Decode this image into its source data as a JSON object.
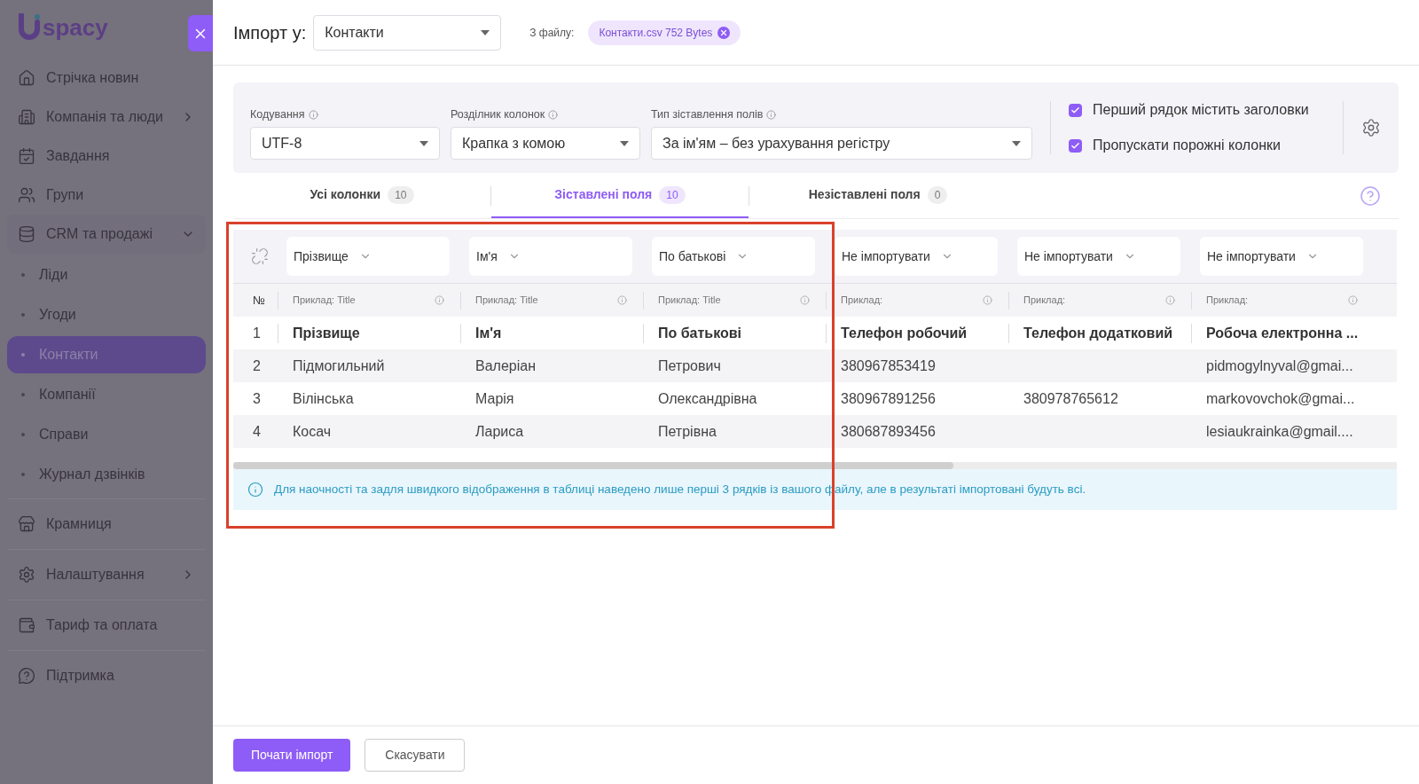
{
  "sidebar": {
    "logo": "spacy",
    "groups": [
      [
        {
          "label": "Стрічка новин"
        },
        {
          "label": "Компанія та люди",
          "expanded": false
        },
        {
          "label": "Завдання"
        },
        {
          "label": "Групи"
        },
        {
          "label": "CRM та продажі",
          "expanded": true,
          "children": [
            {
              "label": "Ліди",
              "selected": false
            },
            {
              "label": "Угоди",
              "selected": false
            },
            {
              "label": "Контакти",
              "selected": true
            },
            {
              "label": "Компанії",
              "selected": false
            },
            {
              "label": "Справи",
              "selected": false
            },
            {
              "label": "Журнал дзвінків",
              "selected": false
            }
          ]
        }
      ],
      [
        {
          "label": "Крамниця"
        }
      ],
      [
        {
          "label": "Налаштування",
          "expanded": false
        }
      ],
      [
        {
          "label": "Тариф та оплата"
        }
      ],
      [
        {
          "label": "Підтримка"
        }
      ]
    ]
  },
  "header": {
    "title": "Імпорт у:",
    "target": "Контакти",
    "file_label": "З файлу:",
    "file": "Контакти.csv 752 Bytes"
  },
  "settings": {
    "fields": [
      {
        "label": "Кодування",
        "value": "UTF-8"
      },
      {
        "label": "Розділник колонок",
        "value": "Крапка з комою"
      },
      {
        "label": "Тип зіставлення полів",
        "value": "За ім'ям – без урахування регістру"
      }
    ],
    "options": [
      {
        "label": "Перший рядок містить заголовки",
        "checked": true
      },
      {
        "label": "Пропускати порожні колонки",
        "checked": true
      }
    ]
  },
  "tabs": [
    {
      "label": "Усі колонки",
      "count": "10",
      "selected": false
    },
    {
      "label": "Зіставлені поля",
      "count": "10",
      "selected": true
    },
    {
      "label": "Незіставлені поля",
      "count": "0",
      "selected": false
    }
  ],
  "table": {
    "number_heading": "№",
    "columns": [
      {
        "field": "Прізвище",
        "example": "Приклад: Title"
      },
      {
        "field": "Ім'я",
        "example": "Приклад: Title"
      },
      {
        "field": "По батькові",
        "example": "Приклад: Title"
      },
      {
        "field": "Не імпортувати",
        "example": "Приклад:"
      },
      {
        "field": "Не імпортувати",
        "example": "Приклад:"
      },
      {
        "field": "Не імпортувати",
        "example": "Приклад:"
      }
    ],
    "rows": [
      {
        "number": "1",
        "kind": "header",
        "cells": [
          "Прізвище",
          "Ім'я",
          "По батькові",
          "Телефон робочий",
          "Телефон додатковий",
          "Робоча електронна ..."
        ]
      },
      {
        "number": "2",
        "kind": "data",
        "cells": [
          "Підмогильний",
          "Валеріан",
          "Петрович",
          "380967853419",
          "",
          "pidmogylnyval@gmai..."
        ]
      },
      {
        "number": "3",
        "kind": "data",
        "cells": [
          "Вілінська",
          "Марія",
          "Олександрівна",
          "380967891256",
          "380978765612",
          "markovovchok@gmai..."
        ]
      },
      {
        "number": "4",
        "kind": "data",
        "cells": [
          "Косач",
          "Лариса",
          "Петрівна",
          "380687893456",
          "",
          "lesiaukrainka@gmail...."
        ]
      }
    ]
  },
  "notice": "Для наочності та задля швидкого відображення в таблиці наведено лише перші 3 рядків із вашого файлу, але в результаті імпортовані будуть всі.",
  "footer": {
    "buttons": [
      {
        "label": "Почати імпорт",
        "kind": "primary"
      },
      {
        "label": "Скасувати",
        "kind": "secondary"
      }
    ]
  }
}
